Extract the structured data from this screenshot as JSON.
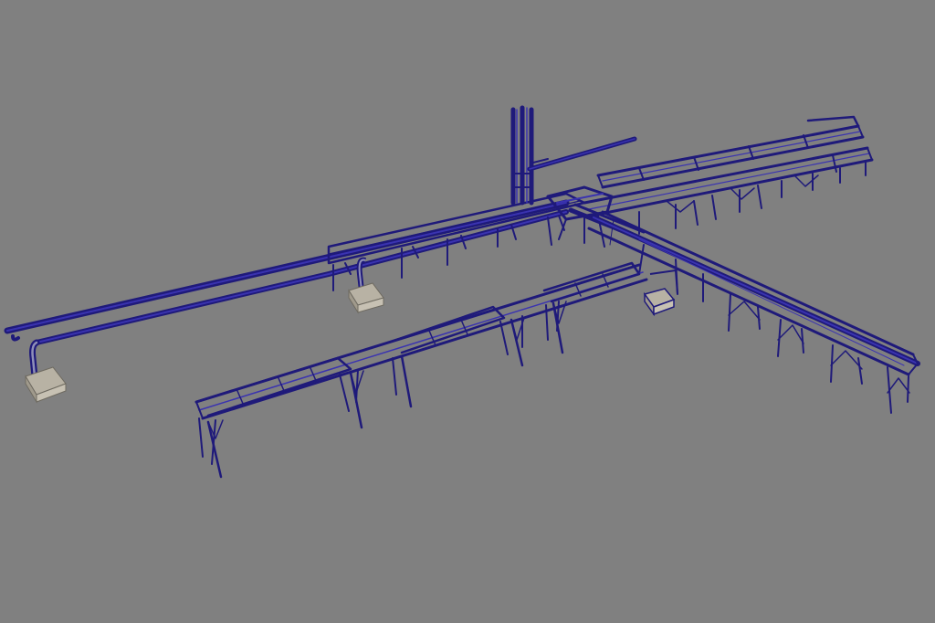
{
  "viewport": {
    "background": "#808080",
    "wire_color": "#1f1a7a",
    "wire_color_light": "#3a33b0",
    "concrete_color": "#b8b2a4",
    "concrete_edge": "#6e6a60"
  }
}
